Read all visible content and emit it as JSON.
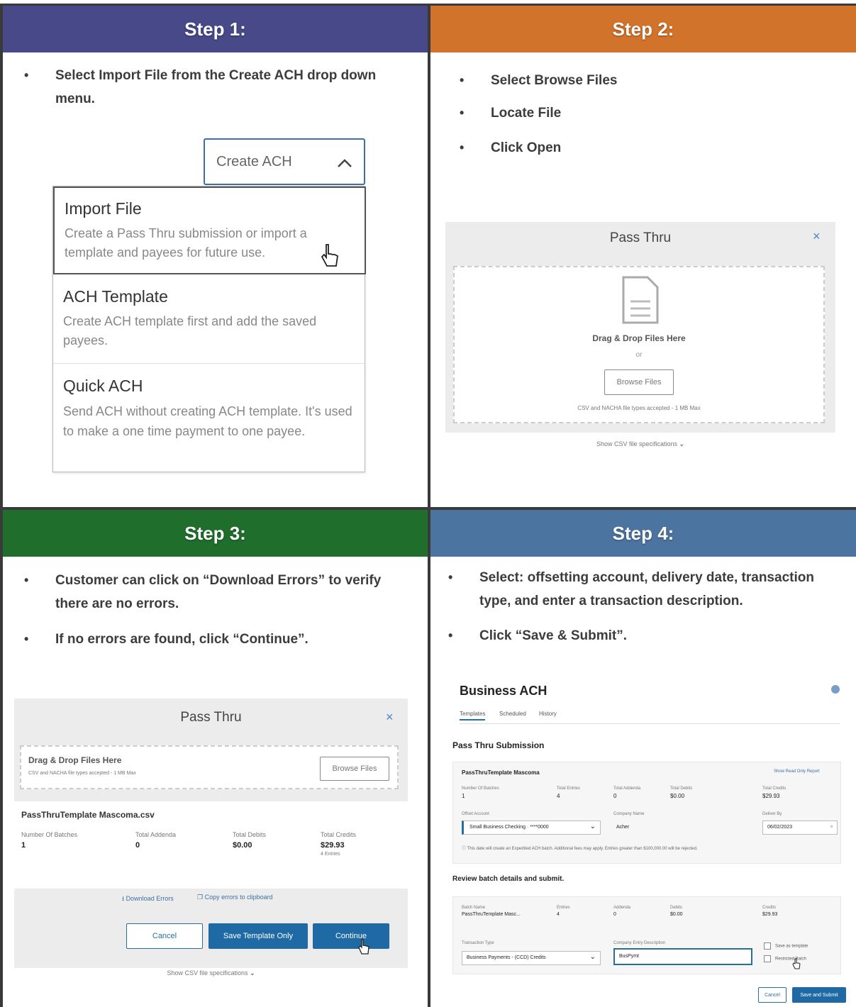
{
  "colors": {
    "step1": "#474989",
    "step2": "#d2732b",
    "step3": "#1f6e2c",
    "step4": "#4c74a0"
  },
  "step1": {
    "title": "Step 1:",
    "bullet": "Select Import File from the Create ACH drop down menu.",
    "dropdown": {
      "label": "Create ACH",
      "icon": "chevron-up-icon",
      "items": [
        {
          "title": "Import File",
          "desc": "Create a Pass Thru submission or import a template and payees for future use."
        },
        {
          "title": "ACH Template",
          "desc": "Create ACH template first and add the saved payees."
        },
        {
          "title": "Quick ACH",
          "desc": "Send ACH without creating ACH template. It's used to make a one time payment to one payee."
        }
      ]
    }
  },
  "step2": {
    "title": "Step 2:",
    "bullets": [
      "Select Browse Files",
      "Locate File",
      "Click Open"
    ],
    "modal": {
      "title": "Pass Thru",
      "close": "×",
      "drag": "Drag & Drop Files Here",
      "or": "or",
      "browse": "Browse Files",
      "accepted": "CSV and NACHA file types accepted - 1 MB Max",
      "spec": "Show CSV file specifications"
    }
  },
  "step3": {
    "title": "Step 3:",
    "bullets": [
      "Customer can click on “Download Errors” to verify there are no errors.",
      "If no errors are found, click “Continue”."
    ],
    "modal": {
      "title": "Pass Thru",
      "close": "×",
      "drag": "Drag & Drop Files Here",
      "accepted": "CSV and NACHA file types accepted - 1 MB Max",
      "browse": "Browse Files",
      "file": "PassThruTemplate Mascoma.csv",
      "stats": [
        {
          "label": "Number Of Batches",
          "value": "1"
        },
        {
          "label": "Total Addenda",
          "value": "0"
        },
        {
          "label": "Total Debits",
          "value": "$0.00"
        },
        {
          "label": "Total Credits",
          "value": "$29.93",
          "sub": "4 Entries"
        }
      ],
      "download": "Download Errors",
      "copy": "Copy errors to clipboard",
      "cancel": "Cancel",
      "save": "Save Template Only",
      "continue": "Continue",
      "spec": "Show CSV file specifications"
    }
  },
  "step4": {
    "title": "Step 4:",
    "bullets": [
      "Select: offsetting account, delivery date, transaction type, and enter a transaction description.",
      "Click “Save & Submit”."
    ],
    "app": {
      "title": "Business ACH",
      "tabs": [
        "Templates",
        "Scheduled",
        "History"
      ],
      "section": "Pass Thru Submission",
      "template": "PassThruTemplate Mascoma",
      "report": "Show Read Only Report",
      "stats": [
        {
          "label": "Number Of Batches",
          "value": "1"
        },
        {
          "label": "Total Entries",
          "value": "4"
        },
        {
          "label": "Total Addenda",
          "value": "0"
        },
        {
          "label": "Total Debits",
          "value": "$0.00"
        },
        {
          "label": "Total Credits",
          "value": "$29.93"
        }
      ],
      "offset_label": "Offset Account",
      "offset_value": "Small Business Checking · ****0000",
      "company_label": "Company Name",
      "company_value": "Acher",
      "deliver_label": "Deliver By",
      "deliver_value": "06/02/2023",
      "notice": "This date will create an Expedited ACH batch. Additional fees may apply. Entries greater than $100,000.00 will be rejected.",
      "review": "Review batch details and submit.",
      "batch": [
        {
          "label": "Batch Name",
          "value": "PassThruTemplate Masc..."
        },
        {
          "label": "Entries",
          "value": "4"
        },
        {
          "label": "Addenda",
          "value": "0"
        },
        {
          "label": "Debits",
          "value": "$0.00"
        },
        {
          "label": "Credits",
          "value": "$29.93"
        }
      ],
      "type_label": "Transaction Type",
      "type_value": "Business Payments - (CCD) Credits",
      "desc_label": "Company Entry Description",
      "desc_value": "BusPymt",
      "save_template": "Save as template",
      "restricted": "Restricted Batch",
      "cancel": "Cancel",
      "submit": "Save and Submit"
    }
  }
}
